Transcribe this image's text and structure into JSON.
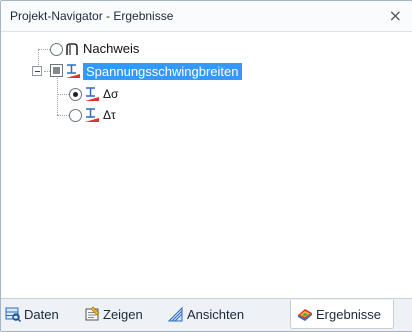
{
  "window": {
    "title": "Projekt-Navigator - Ergebnisse",
    "close": "×"
  },
  "tree": {
    "nachweis": {
      "label": "Nachweis",
      "state": "unchecked"
    },
    "spannung": {
      "label": "Spannungsschwingbreiten",
      "state": "indeterminate",
      "expanded": true,
      "selected": true
    },
    "children": [
      {
        "label": "Δσ",
        "state": "checked"
      },
      {
        "label": "Δτ",
        "state": "unchecked"
      }
    ]
  },
  "tabs": [
    {
      "label": "Daten",
      "icon": "data-icon"
    },
    {
      "label": "Zeigen",
      "icon": "display-icon"
    },
    {
      "label": "Ansichten",
      "icon": "views-icon"
    },
    {
      "label": "Ergebnisse",
      "icon": "results-icon",
      "active": true
    }
  ],
  "colors": {
    "selection": "#3399ff",
    "accent_red": "#e0342b",
    "accent_blue": "#2d6cc0"
  }
}
